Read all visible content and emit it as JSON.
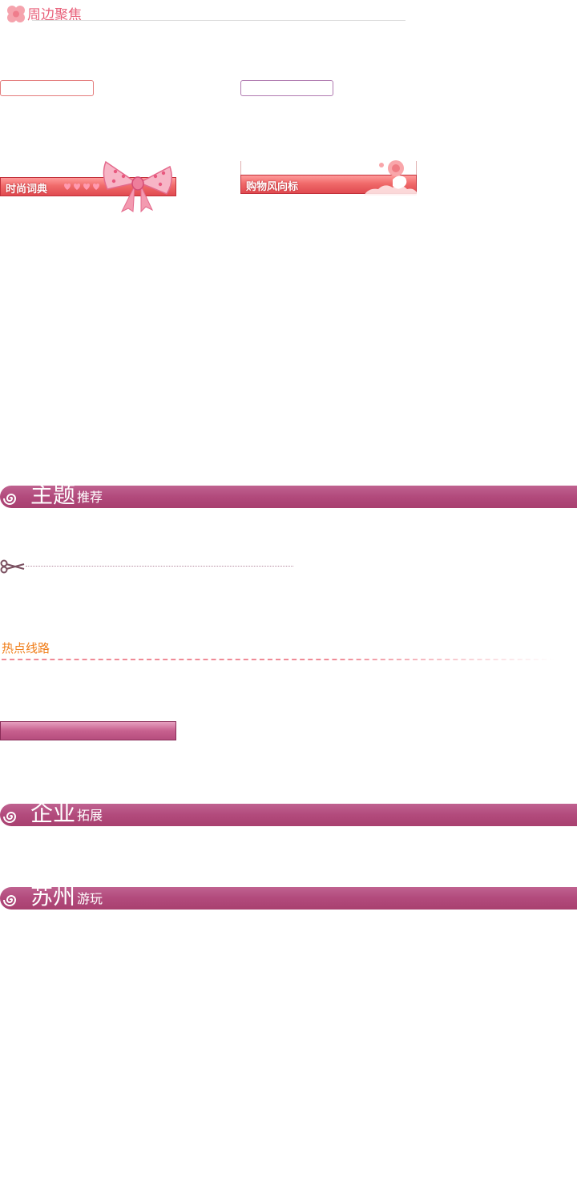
{
  "periphery": {
    "title": "周边聚焦"
  },
  "banners": {
    "dictionary": "时尚词典",
    "shopping": "购物风向标"
  },
  "sections": {
    "theme": {
      "big": "主题",
      "small": "推荐"
    },
    "enterprise": {
      "big": "企业",
      "small": "拓展"
    },
    "suzhou": {
      "big": "苏州",
      "small": "游玩"
    }
  },
  "hot_routes": {
    "title": "热点线路"
  },
  "colors": {
    "accent_red": "#e04a50",
    "accent_purple": "#b24a7c",
    "accent_orange": "#f07d18"
  }
}
